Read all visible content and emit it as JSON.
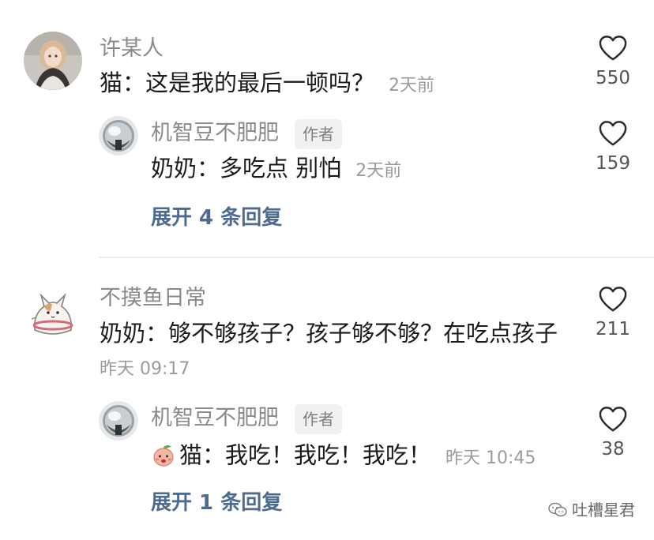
{
  "comments": [
    {
      "avatar": "girl-photo-avatar",
      "username": "许某人",
      "text": "猫：这是我的最后一顿吗？",
      "time": "2天前",
      "likes": "550",
      "replies": [
        {
          "avatar": "chrome-ball-avatar",
          "username": "机智豆不肥肥",
          "badge": "作者",
          "text": "奶奶：多吃点 别怕",
          "time": "2天前",
          "likes": "159"
        }
      ],
      "expand_label": "展开 4 条回复"
    },
    {
      "avatar": "cartoon-cat-avatar",
      "username": "不摸鱼日常",
      "text": "奶奶：够不够孩子？孩子够不够？在吃点孩子",
      "time": "昨天 09:17",
      "likes": "211",
      "replies": [
        {
          "avatar": "chrome-ball-avatar",
          "username": "机智豆不肥肥",
          "badge": "作者",
          "emoji": "peach-face-emoji",
          "text": "猫：我吃！我吃！我吃！",
          "time": "昨天 10:45",
          "likes": "38"
        }
      ],
      "expand_label": "展开 1 条回复"
    }
  ],
  "watermark": {
    "icon": "wechat-icon",
    "text": "吐槽星君"
  },
  "colors": {
    "username": "#8a8a8a",
    "text": "#1b1b1b",
    "time": "#9b9b9b",
    "expand_link": "#4d6b90",
    "badge_bg": "#f1f1f1",
    "divider": "#ececec"
  }
}
